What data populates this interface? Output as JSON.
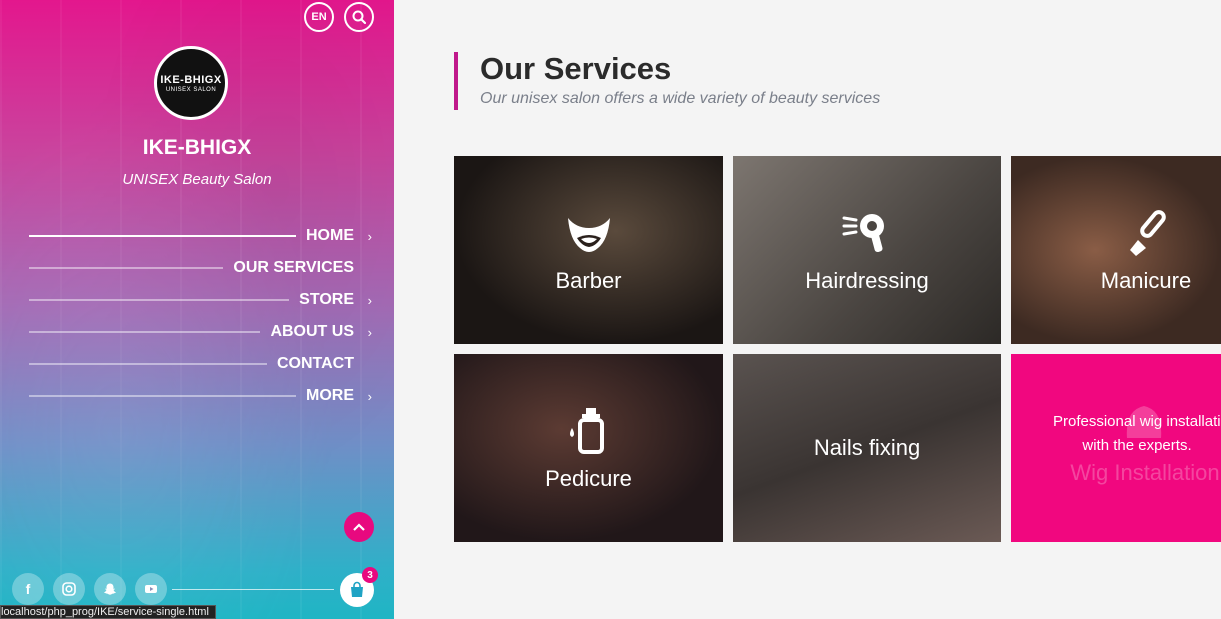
{
  "header": {
    "lang": "EN"
  },
  "brand": {
    "logo_line1": "IKE-BHIGX",
    "logo_line2": "UNISEX SALON",
    "name": "IKE-BHIGX",
    "tagline": "UNISEX Beauty Salon"
  },
  "nav": [
    {
      "label": "HOME",
      "chevron": true,
      "active": true
    },
    {
      "label": "OUR SERVICES",
      "chevron": false,
      "active": false
    },
    {
      "label": "STORE",
      "chevron": true,
      "active": false
    },
    {
      "label": "ABOUT US",
      "chevron": true,
      "active": false
    },
    {
      "label": "CONTACT",
      "chevron": false,
      "active": false
    },
    {
      "label": "MORE",
      "chevron": true,
      "active": false
    }
  ],
  "cart": {
    "count": "3"
  },
  "status_url": "localhost/php_prog/IKE/service-single.html",
  "section": {
    "title": "Our Services",
    "subtitle": "Our unisex salon offers a wide variety of beauty services"
  },
  "services": [
    {
      "name": "Barber",
      "icon": "beard-icon"
    },
    {
      "name": "Hairdressing",
      "icon": "hairdryer-icon"
    },
    {
      "name": "Manicure",
      "icon": "nail-brush-icon"
    },
    {
      "name": "Pedicure",
      "icon": "lotion-bottle-icon"
    },
    {
      "name": "Nails fixing",
      "icon": ""
    },
    {
      "name": "Wig Installation",
      "icon": "wig-icon",
      "description_line1": "Professional wig installation",
      "description_line2": "with the experts."
    }
  ],
  "colors": {
    "accent": "#e8097f",
    "heading_bar": "#c0188b",
    "wig_tile": "#f1077f"
  }
}
